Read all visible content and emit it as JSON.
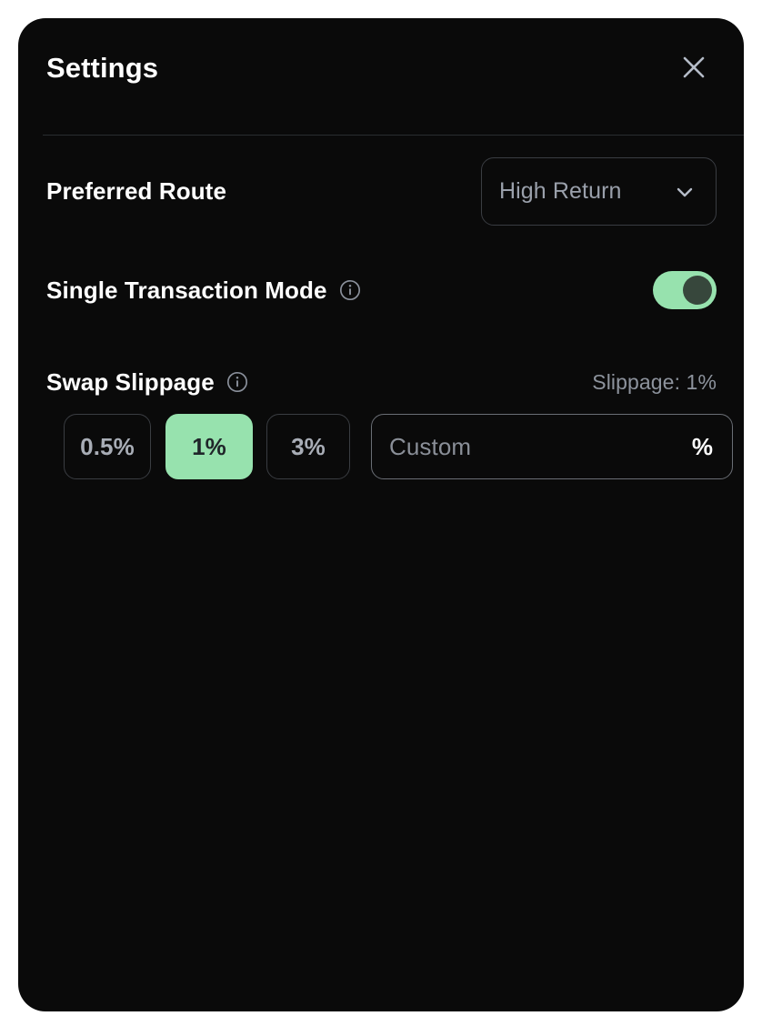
{
  "panel": {
    "title": "Settings",
    "close_icon": "close-icon",
    "background_color": "#0a0a0a",
    "accent_color": "#97e2ae"
  },
  "preferred_route": {
    "label": "Preferred Route",
    "selected_value": "High Return",
    "chevron_icon": "chevron-down-icon"
  },
  "single_transaction_mode": {
    "label": "Single Transaction Mode",
    "info_icon": "info-icon",
    "toggle_state": "on"
  },
  "swap_slippage": {
    "label": "Swap Slippage",
    "info_icon": "info-icon",
    "readout": "Slippage: 1%",
    "options": [
      {
        "label": "0.5%",
        "selected": false
      },
      {
        "label": "1%",
        "selected": true
      },
      {
        "label": "3%",
        "selected": false
      }
    ],
    "custom": {
      "placeholder": "Custom",
      "value": "",
      "suffix": "%"
    }
  }
}
